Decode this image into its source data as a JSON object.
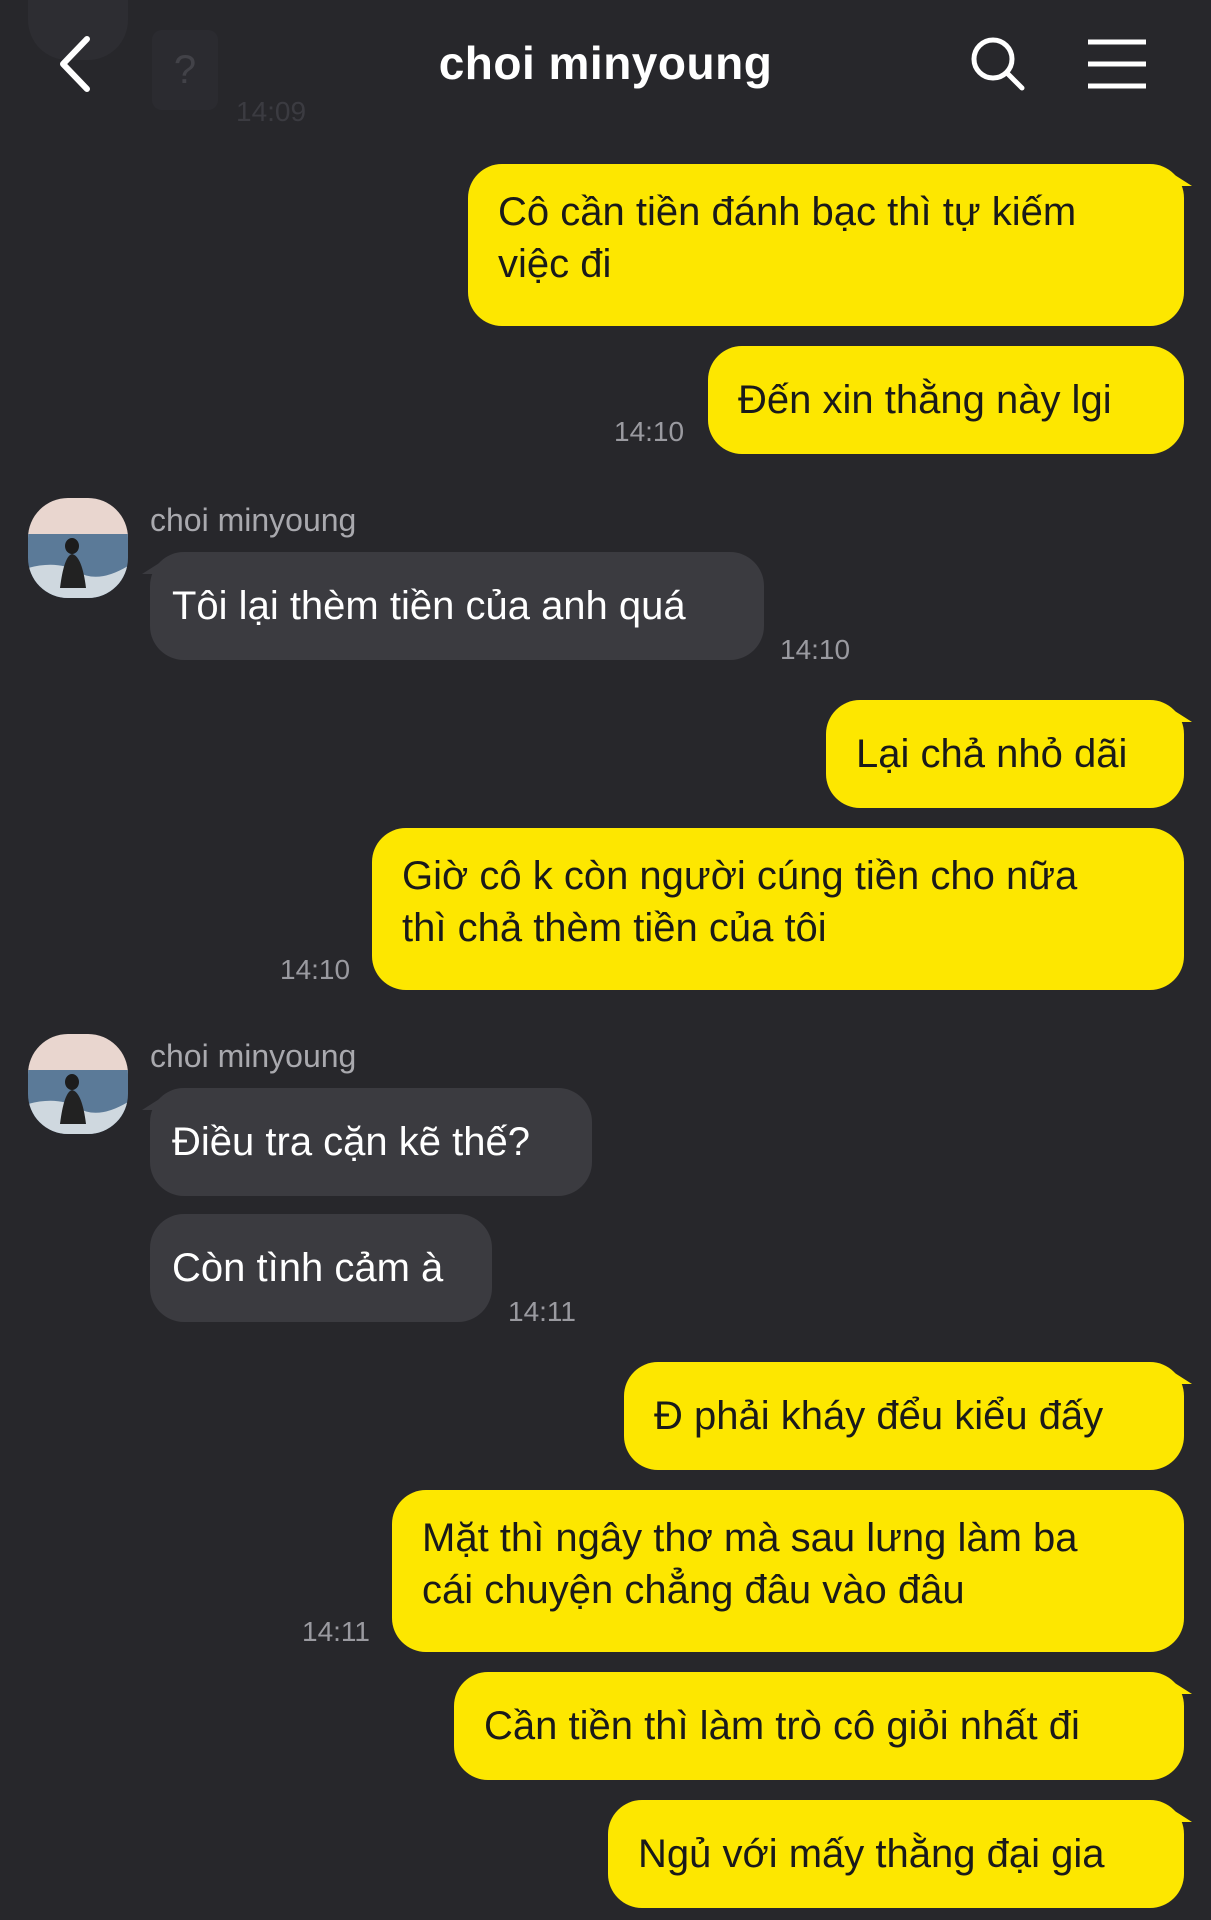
{
  "header": {
    "title": "choi minyoung",
    "previous_time": "14:09",
    "previous_badge": "?"
  },
  "messages": [
    {
      "side": "out",
      "lines": [
        "Cô cần tiền đánh bạc thì tự kiếm",
        "việc đi"
      ]
    },
    {
      "side": "out",
      "text": "Đến xin thằng này lgi",
      "time": "14:10"
    },
    {
      "side": "in",
      "sender": "choi minyoung",
      "text": "Tôi lại thèm tiền của anh quá",
      "time": "14:10"
    },
    {
      "side": "out",
      "text": "Lại chả nhỏ dãi"
    },
    {
      "side": "out",
      "lines": [
        "Giờ cô k còn người cúng tiền cho nữa",
        "thì chả thèm tiền của tôi"
      ],
      "time": "14:10"
    },
    {
      "side": "in",
      "sender": "choi minyoung",
      "text": "Điều tra cặn kẽ thế?"
    },
    {
      "side": "in",
      "text": "Còn tình cảm à",
      "time": "14:11"
    },
    {
      "side": "out",
      "text": "Đ phải kháy đểu kiểu đấy"
    },
    {
      "side": "out",
      "lines": [
        "Mặt thì ngây thơ mà sau lưng làm ba",
        "cái chuyện chẳng đâu vào đâu"
      ],
      "time": "14:11"
    },
    {
      "side": "out",
      "text": "Cần tiền thì làm trò cô giỏi nhất đi"
    },
    {
      "side": "out",
      "text": "Ngủ với mấy thằng đại gia"
    }
  ],
  "colors": {
    "background": "#27272b",
    "outgoing_bubble": "#fde700",
    "incoming_bubble": "#3b3b40"
  },
  "icons": {
    "back": "chevron-left-icon",
    "search": "search-icon",
    "menu": "hamburger-menu-icon"
  }
}
